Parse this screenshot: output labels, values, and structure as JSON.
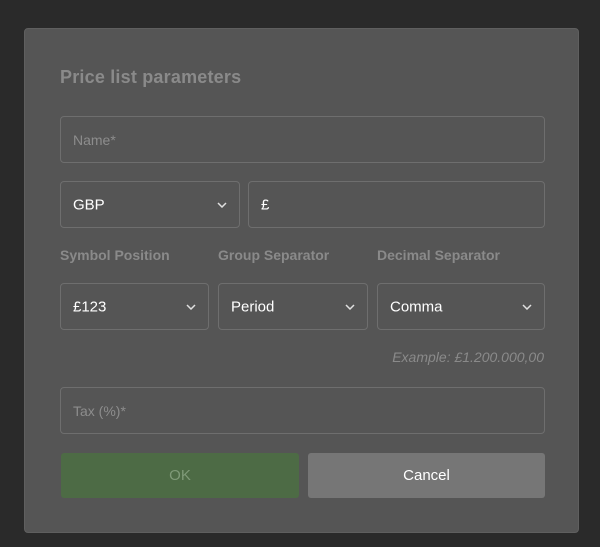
{
  "dialog": {
    "title": "Price list parameters",
    "name_placeholder": "Name*",
    "currency": {
      "value": "GBP"
    },
    "symbol": {
      "value": "£"
    },
    "labels": {
      "symbol_position": "Symbol Position",
      "group_separator": "Group Separator",
      "decimal_separator": "Decimal Separator"
    },
    "symbol_position": {
      "value": "£123"
    },
    "group_separator": {
      "value": "Period"
    },
    "decimal_separator": {
      "value": "Comma"
    },
    "example": "Example: £1.200.000,00",
    "tax_placeholder": "Tax (%)*",
    "ok_label": "OK",
    "cancel_label": "Cancel"
  },
  "colors": {
    "background": "#2a2a2a",
    "panel": "#555555",
    "ok_button_disabled": "#4d6b45",
    "cancel_button": "#767676"
  },
  "icons": {
    "dropdown": "chevron-down-icon"
  }
}
